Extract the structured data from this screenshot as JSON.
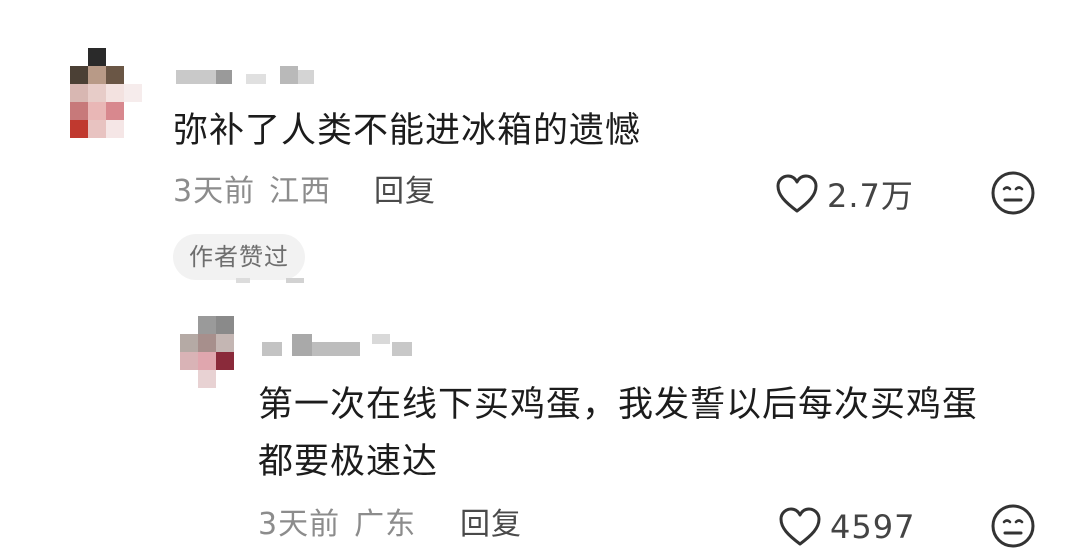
{
  "comments": [
    {
      "text": "弥补了人类不能进冰箱的遗憾",
      "time": "3天前",
      "location": "江西",
      "reply_label": "回复",
      "likes": "2.7万",
      "badge": "作者赞过",
      "like_icon": "heart-outline-icon",
      "dislike_icon": "meh-face-icon"
    }
  ],
  "replies": [
    {
      "text_line1": "第一次在线下买鸡蛋，我发誓以后每次买鸡蛋",
      "text_line2": "都要极速达",
      "time": "3天前",
      "location": "广东",
      "reply_label": "回复",
      "likes": "4597",
      "like_icon": "heart-outline-icon",
      "dislike_icon": "meh-face-icon"
    }
  ],
  "colors": {
    "text_primary": "#1c1c1c",
    "text_meta": "#8c8c8c",
    "badge_bg": "#f2f2f2",
    "icon": "#333333"
  }
}
